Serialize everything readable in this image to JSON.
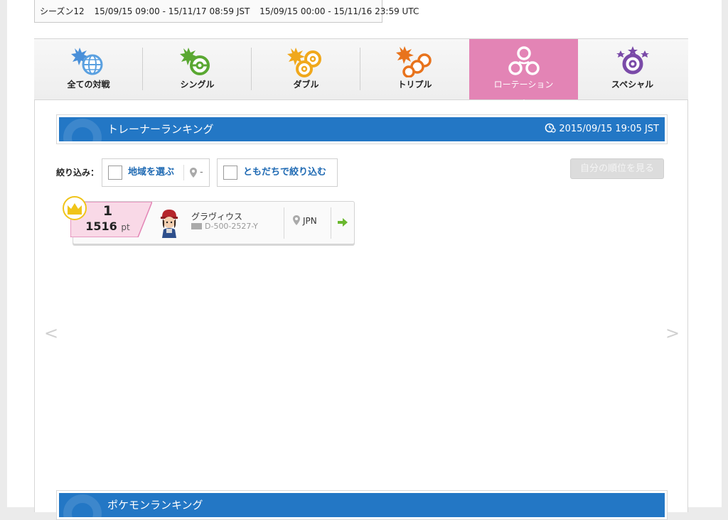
{
  "season": {
    "name": "シーズン12",
    "jst": "15/09/15 09:00 - 15/11/17 08:59 JST",
    "utc": "15/09/15 00:00 - 15/11/16 23:59 UTC"
  },
  "tabs": [
    {
      "label": "全ての対戦",
      "icon": "all-battles-icon",
      "color": "#4a90d9"
    },
    {
      "label": "シングル",
      "icon": "single-battle-icon",
      "color": "#5aa832"
    },
    {
      "label": "ダブル",
      "icon": "double-battle-icon",
      "color": "#f0a81c"
    },
    {
      "label": "トリプル",
      "icon": "triple-battle-icon",
      "color": "#e8731c"
    },
    {
      "label": "ローテーション",
      "icon": "rotation-battle-icon",
      "color": "#e384b5",
      "active": true
    },
    {
      "label": "スペシャル",
      "icon": "special-battle-icon",
      "color": "#7a4aa8"
    }
  ],
  "trainer_ranking": {
    "title": "トレーナーランキング",
    "updated": "2015/09/15 19:05 JST"
  },
  "filters": {
    "label": "絞り込み：",
    "region": "地域を選ぶ",
    "region_value": "-",
    "friends": "ともだちで絞り込む",
    "my_rank_button": "自分の順位を見る"
  },
  "rankings": [
    {
      "rank": "1",
      "points": "1516",
      "unit": "pt",
      "name": "グラヴィウス",
      "id": "D-500-2527-Y",
      "country": "JPN"
    }
  ],
  "pokemon_ranking": {
    "title": "ポケモンランキング"
  },
  "nav": {
    "prev": "<",
    "next": ">"
  },
  "colors": {
    "header_blue": "#2377c5",
    "active_tab": "#e384b5",
    "link_blue": "#1f6ab3",
    "rank_pink": "#f9d9e7"
  }
}
